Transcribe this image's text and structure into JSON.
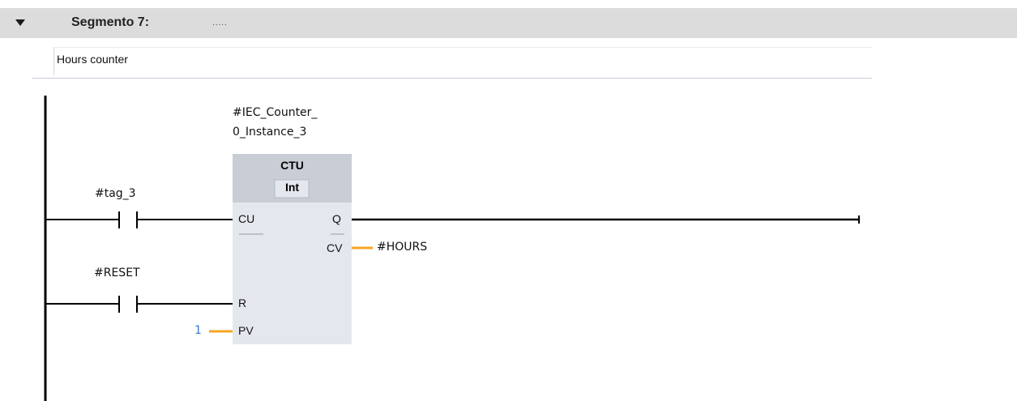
{
  "segment": {
    "title": "Segmento 7:",
    "title_placeholder": ".....",
    "comment": "Hours counter"
  },
  "block": {
    "instance_line1": "#IEC_Counter_",
    "instance_line2": "0_Instance_3",
    "type": "CTU",
    "data_type": "Int",
    "pins": {
      "cu": "CU",
      "r": "R",
      "pv": "PV",
      "q": "Q",
      "cv": "CV"
    },
    "pv_value": "1",
    "cv_output": "#HOURS"
  },
  "contacts": [
    {
      "tag": "#tag_3"
    },
    {
      "tag": "#RESET"
    }
  ],
  "colors": {
    "header_bg": "#dcdcdc",
    "block_bg": "#e4e8ee",
    "block_header_bg": "#c9ced6",
    "connector_orange": "#f5a623",
    "constant_blue": "#3a78d0",
    "wire": "#000000"
  }
}
